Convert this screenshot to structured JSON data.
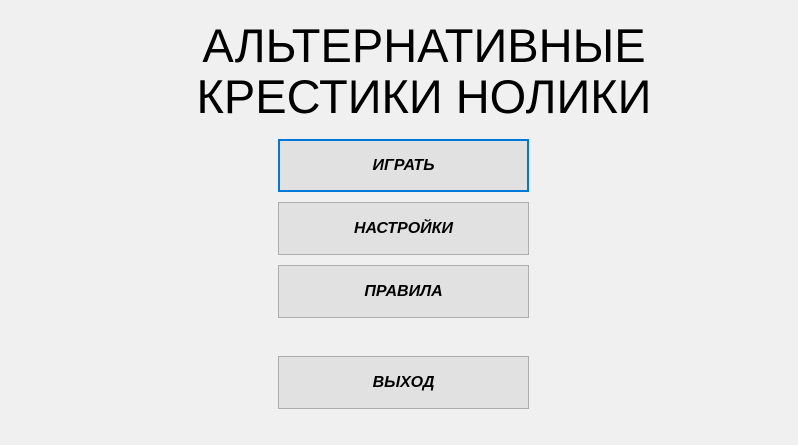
{
  "title": {
    "line1": "АЛЬТЕРНАТИВНЫЕ",
    "line2": "КРЕСТИКИ НОЛИКИ"
  },
  "menu": {
    "play_label": "ИГРАТЬ",
    "settings_label": "НАСТРОЙКИ",
    "rules_label": "ПРАВИЛА",
    "exit_label": "ВЫХОД"
  },
  "colors": {
    "background": "#f0f0f0",
    "button_face": "#e1e1e1",
    "button_border": "#adadad",
    "focus_border": "#0078d7"
  }
}
